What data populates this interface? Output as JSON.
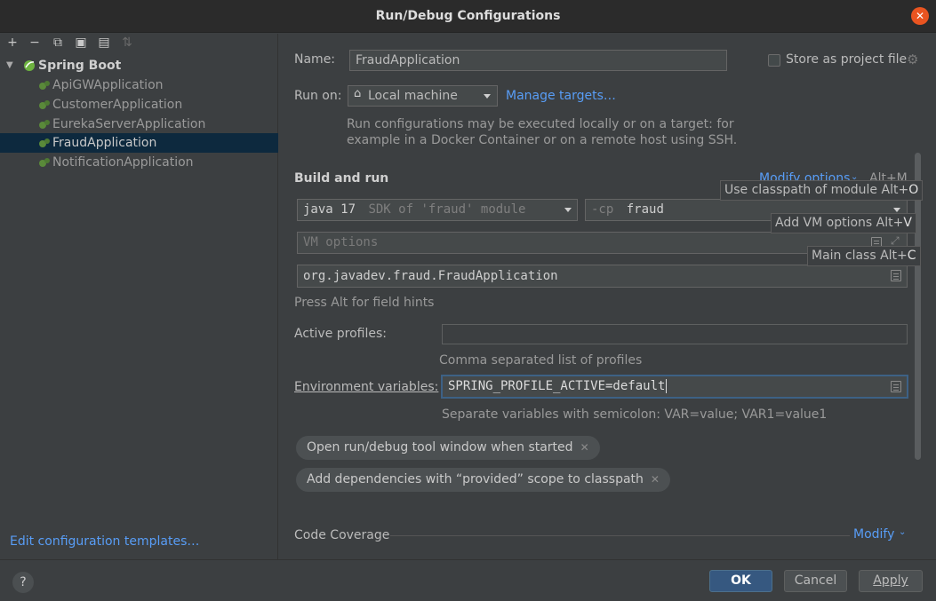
{
  "window": {
    "title": "Run/Debug Configurations",
    "close_icon": "close-icon"
  },
  "toolbar": {
    "icons": [
      "add-icon",
      "remove-icon",
      "copy-icon",
      "save-icon",
      "new-folder-icon",
      "sort-icon"
    ],
    "glyphs": [
      "+",
      "−",
      "⧉",
      "▣",
      "▤",
      "⇅"
    ]
  },
  "tree": {
    "group_label": "Spring Boot",
    "items": [
      {
        "label": "ApiGWApplication",
        "selected": false
      },
      {
        "label": "CustomerApplication",
        "selected": false
      },
      {
        "label": "EurekaServerApplication",
        "selected": false
      },
      {
        "label": "FraudApplication",
        "selected": true
      },
      {
        "label": "NotificationApplication",
        "selected": false
      }
    ]
  },
  "left_footer": {
    "templates_link": "Edit configuration templates…"
  },
  "form": {
    "name_label": "Name:",
    "name_value": "FraudApplication",
    "store_label": "Store as project file",
    "run_on_label": "Run on:",
    "run_on_value": "Local machine",
    "manage_targets": "Manage targets…",
    "run_on_hint_1": "Run configurations may be executed locally or on a target: for",
    "run_on_hint_2": "example in a Docker Container or on a remote host using SSH.",
    "build_run_heading": "Build and run",
    "modify_options": "Modify options",
    "modify_options_shortcut": "Alt+M",
    "sdk_value": "java 17",
    "sdk_hint": "SDK of 'fraud' module",
    "cp_prefix": "-cp",
    "cp_value": "fraud",
    "vm_placeholder": "VM options",
    "main_class_value": "org.javadev.fraud.FraudApplication",
    "field_hints_note": "Press Alt for field hints",
    "active_profiles_label": "Active profiles:",
    "active_profiles_value": "",
    "active_profiles_hint": "Comma separated list of profiles",
    "env_label": "Environment variables:",
    "env_value": "SPRING_PROFILE_ACTIVE=default",
    "env_hint": "Separate variables with semicolon: VAR=value; VAR1=value1",
    "chip_1": "Open run/debug tool window when started",
    "chip_2": "Add dependencies with “provided” scope to classpath",
    "coverage_label": "Code Coverage",
    "coverage_modify": "Modify"
  },
  "tooltips": {
    "classpath": "Use classpath of module Alt+",
    "classpath_key": "O",
    "vm": "Add VM options Alt+",
    "vm_key": "V",
    "main": "Main class Alt+",
    "main_key": "C"
  },
  "buttons": {
    "help": "?",
    "ok": "OK",
    "cancel": "Cancel",
    "apply": "Apply"
  },
  "colors": {
    "accent": "#589df6",
    "selection": "#0d293e",
    "ok_button": "#365880",
    "close_button": "#e95420",
    "spring_icon": "#6db33f"
  }
}
